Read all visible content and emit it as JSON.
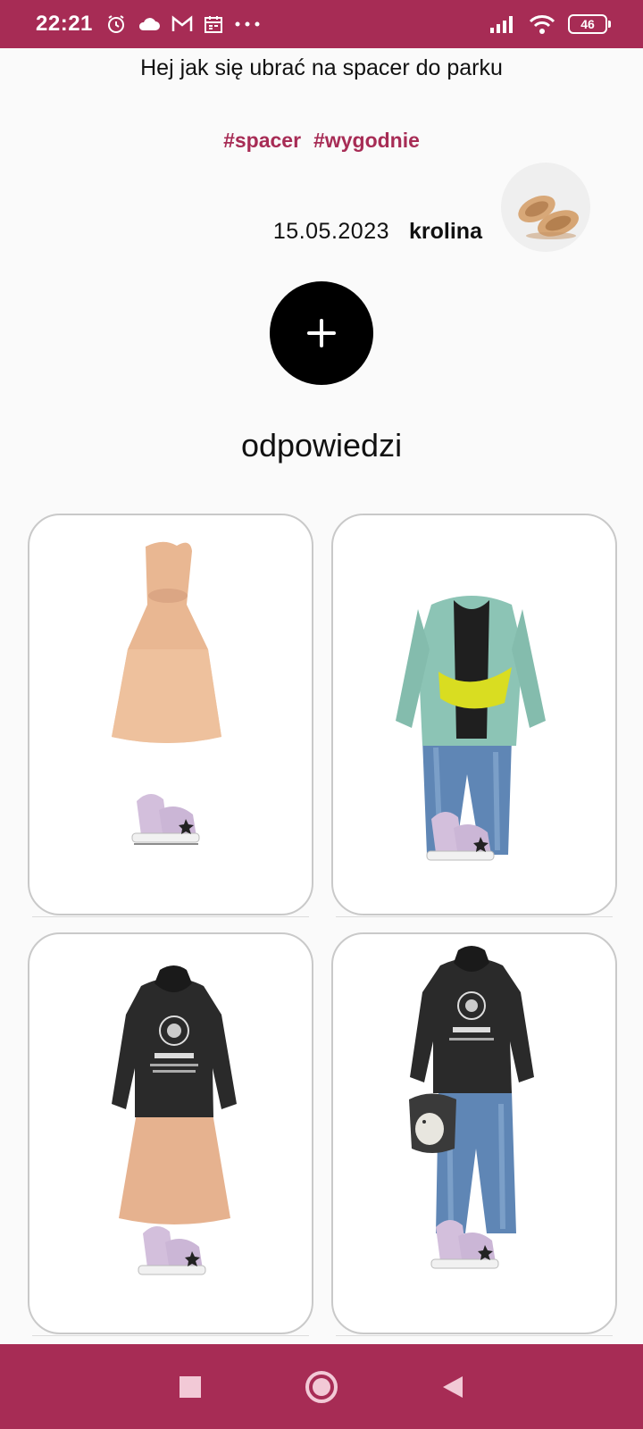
{
  "status_bar": {
    "time": "22:21",
    "battery": "46",
    "icons_left": [
      "alarm-icon",
      "cloud-icon",
      "gmail-icon",
      "calendar-icon",
      "more-icon"
    ],
    "icons_right": [
      "signal-icon",
      "wifi-icon",
      "battery-icon"
    ]
  },
  "post": {
    "question": "Hej jak się ubrać na spacer do parku",
    "tags": [
      "#spacer",
      "#wygodnie"
    ],
    "date": "15.05.2023",
    "author": "krolina",
    "avatar_icon": "sandals-avatar"
  },
  "add_button": {
    "icon": "plus-icon"
  },
  "answers": {
    "title": "odpowiedzi",
    "items": [
      {
        "icon": "outfit-dress-sneakers"
      },
      {
        "icon": "outfit-cardigan-jeans-beltbag"
      },
      {
        "icon": "outfit-hoodie-skirt"
      },
      {
        "icon": "outfit-hoodie-jeans-bag"
      }
    ]
  },
  "colors": {
    "brand": "#a72c55",
    "background": "#fafafa",
    "add_button": "#000000",
    "nav_icon": "#f2c9d6"
  },
  "nav_bar": {
    "buttons": [
      "recent-apps-icon",
      "home-icon",
      "back-icon"
    ]
  }
}
